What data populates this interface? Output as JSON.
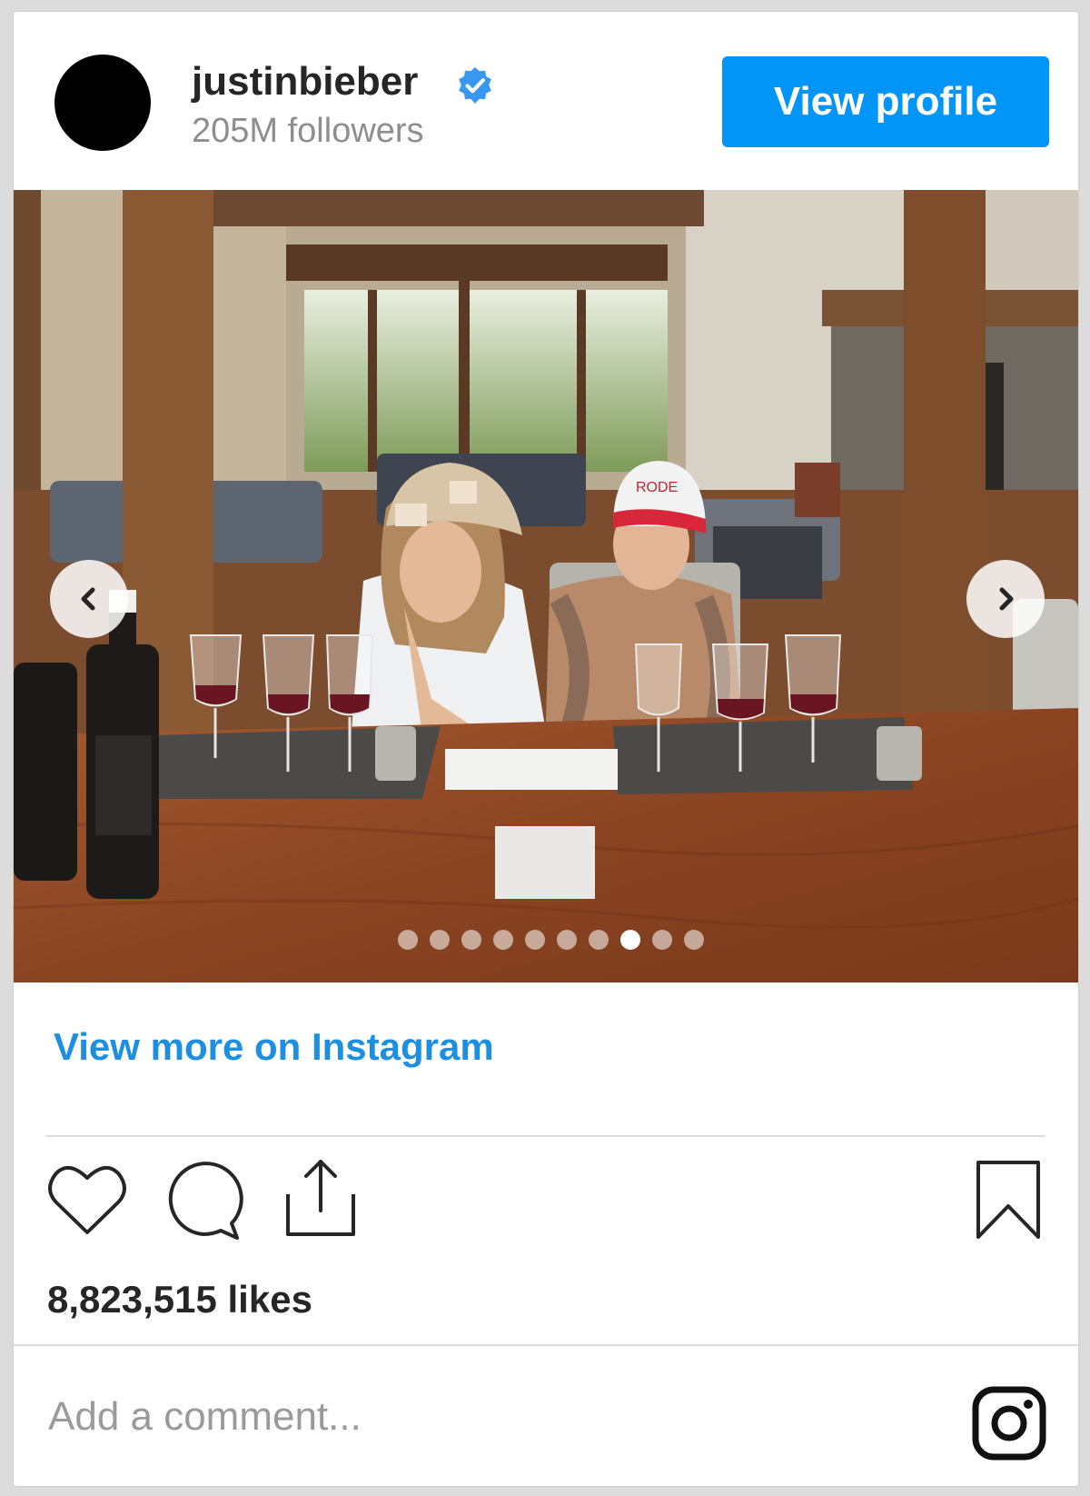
{
  "header": {
    "username": "justinbieber",
    "followers": "205M followers",
    "view_profile_label": "View profile",
    "verified_icon": "verified-badge-icon"
  },
  "post": {
    "photo_alt": "Two people seated at a wooden wine tasting table with rows of red wine glasses",
    "carousel": {
      "total_slides": 10,
      "active_index": 7
    }
  },
  "footer": {
    "view_more_label": "View more on Instagram",
    "likes": "8,823,515 likes",
    "comment_placeholder": "Add a comment..."
  },
  "icons": {
    "like": "heart-icon",
    "comment": "comment-icon",
    "share": "share-icon",
    "save": "bookmark-icon",
    "brand": "instagram-logo-icon"
  },
  "colors": {
    "accent": "#0095f6",
    "link": "#1d8fe0",
    "text": "#262626",
    "muted": "#8e8e8e"
  }
}
